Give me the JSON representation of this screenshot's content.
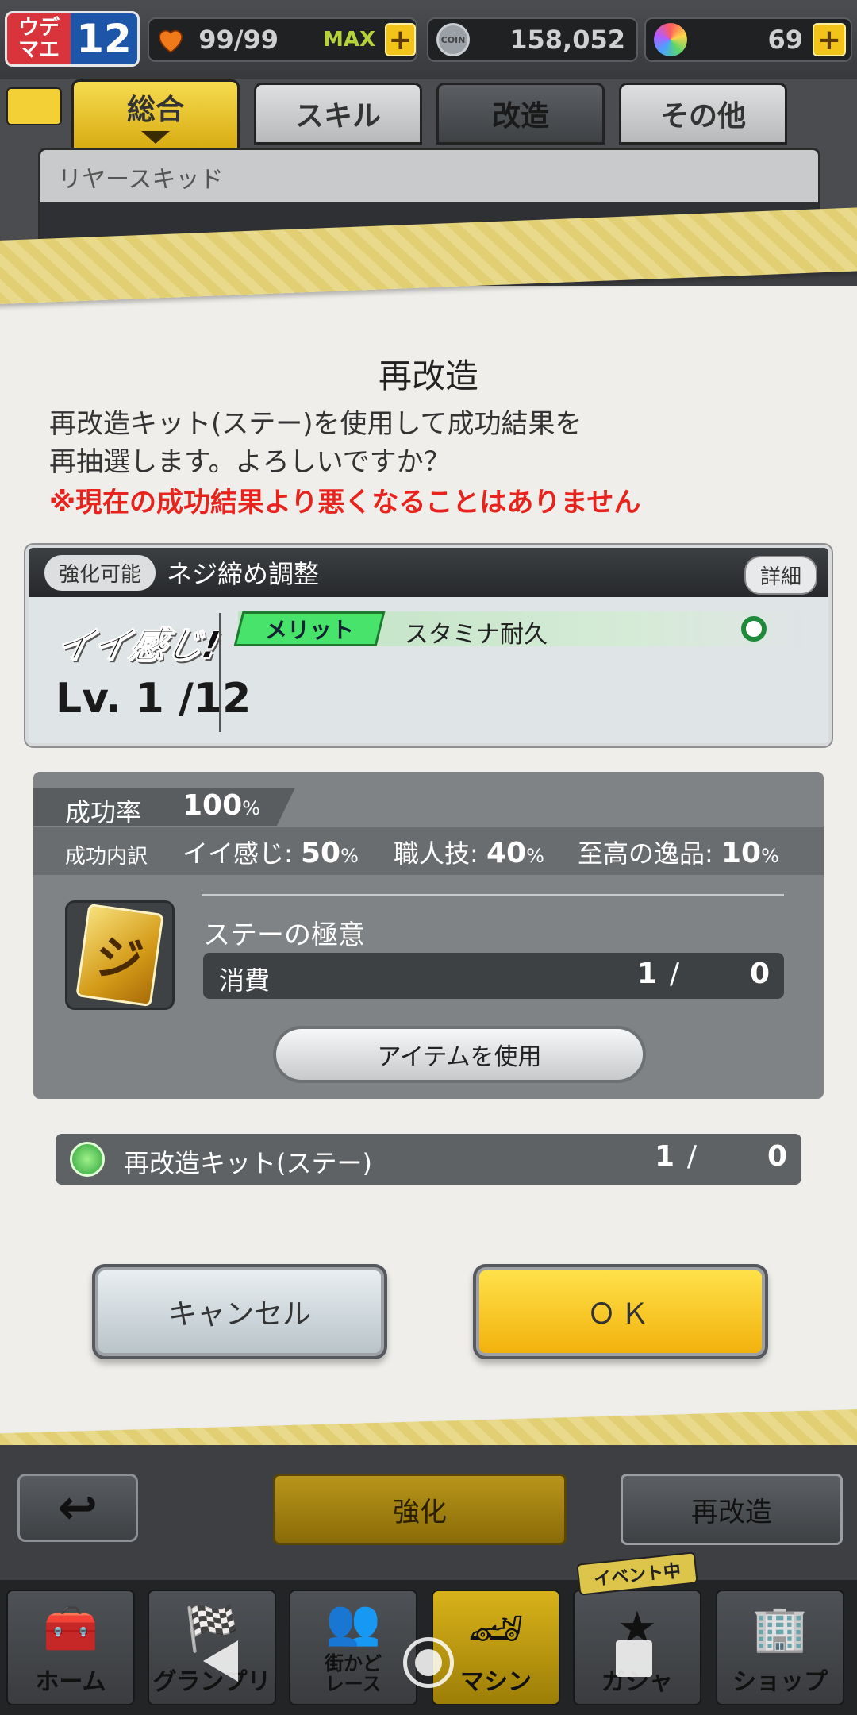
{
  "status": {
    "rank_label": "ウデマエ",
    "rank_value": "12",
    "stamina": "99/99",
    "stamina_max": "MAX",
    "coin_label": "COIN",
    "coins": "158,052",
    "gems": "69"
  },
  "machine": {
    "tabs": [
      "総合",
      "スキル",
      "改造",
      "その他"
    ],
    "part_name": "リヤースキッド"
  },
  "dialog": {
    "title": "再改造",
    "message_line1": "再改造キット(ステー)を使用して成功結果を",
    "message_line2": "再抽選します。よろしいですか？",
    "warning": "※現在の成功結果より悪くなることはありません",
    "upgrade": {
      "badge": "強化可能",
      "name": "ネジ締め調整",
      "detail_label": "詳細",
      "result_label": "イイ感じ!",
      "level": "Lv. 1 /12",
      "merit_label": "メリット",
      "merit_stat": "スタミナ耐久"
    },
    "success": {
      "rate_label": "成功率",
      "rate_value": "100",
      "breakdown_label": "成功内訳",
      "good_label": "イイ感じ:",
      "good_value": "50",
      "craft_label": "職人技:",
      "craft_value": "40",
      "best_label": "至高の逸品:",
      "best_value": "10",
      "percent": "%"
    },
    "item": {
      "name": "ステーの極意",
      "consume_label": "消費",
      "consume_have": "1",
      "consume_need": "0",
      "use_button": "アイテムを使用"
    },
    "kit": {
      "name": "再改造キット(ステー)",
      "have": "1",
      "need": "0"
    },
    "cancel": "キャンセル",
    "ok": "ＯＫ"
  },
  "actions": {
    "strengthen": "強化",
    "remodel": "再改造"
  },
  "nav": {
    "items": [
      {
        "label": "ホーム",
        "icon": "toolbox-icon"
      },
      {
        "label": "グランプリ",
        "icon": "checkered-flag-icon"
      },
      {
        "label": "街かど\nレース",
        "icon": "people-icon"
      },
      {
        "label": "マシン",
        "icon": "car-icon"
      },
      {
        "label": "ガシャ",
        "icon": "star-icon"
      },
      {
        "label": "ショップ",
        "icon": "building-icon"
      }
    ],
    "event_tag": "イベント中"
  },
  "colors": {
    "ok_button": "#f2b20c",
    "warning_text": "#e8231d",
    "merit_green": "#48e36b"
  }
}
